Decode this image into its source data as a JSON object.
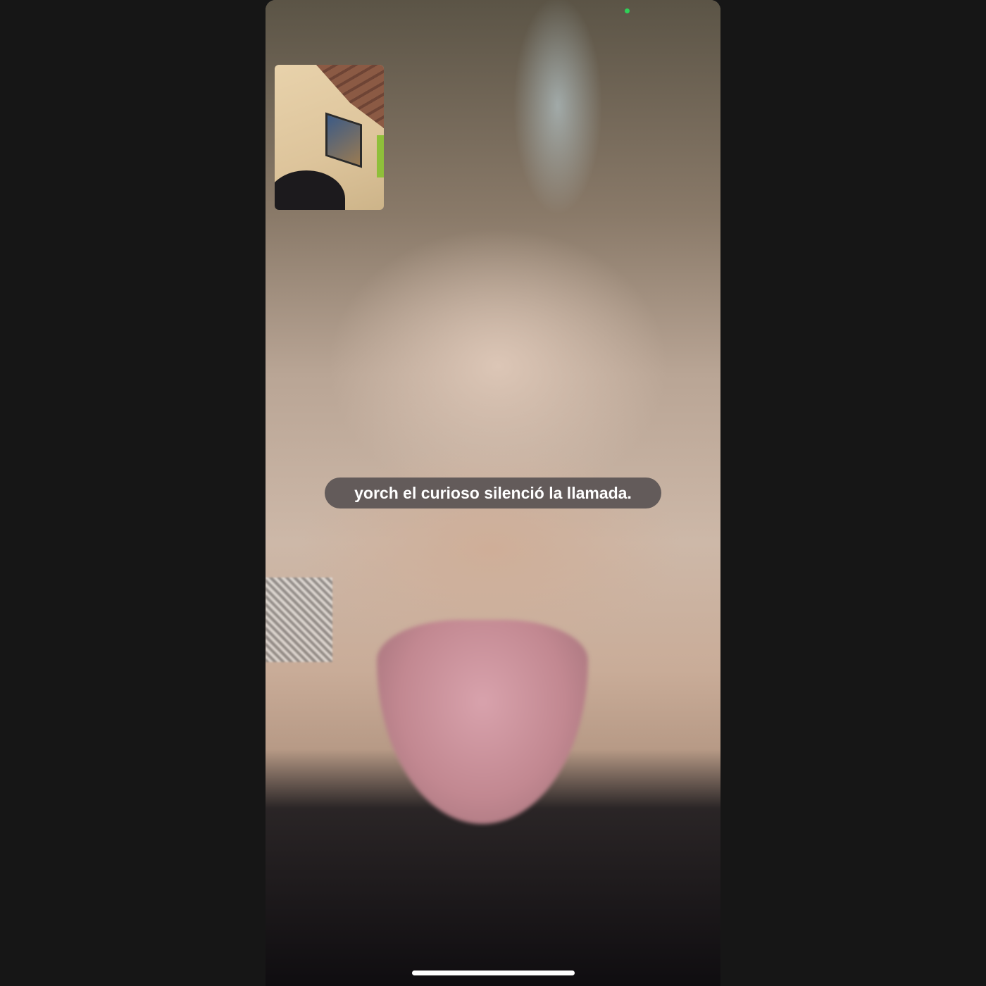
{
  "call": {
    "status_message": "yorch el curioso silenció la llamada.",
    "indicator_color": "#2ed158",
    "self_view": "camera-preview",
    "remote_view": "video-feed"
  }
}
